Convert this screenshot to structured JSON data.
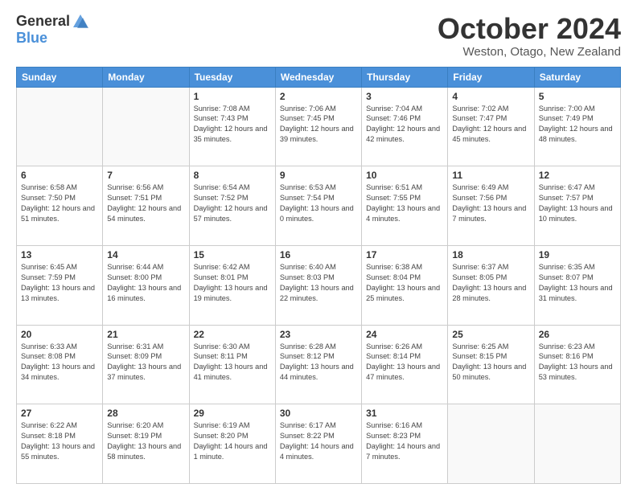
{
  "logo": {
    "general": "General",
    "blue": "Blue"
  },
  "header": {
    "month": "October 2024",
    "location": "Weston, Otago, New Zealand"
  },
  "days_of_week": [
    "Sunday",
    "Monday",
    "Tuesday",
    "Wednesday",
    "Thursday",
    "Friday",
    "Saturday"
  ],
  "weeks": [
    [
      {
        "day": "",
        "info": ""
      },
      {
        "day": "",
        "info": ""
      },
      {
        "day": "1",
        "info": "Sunrise: 7:08 AM\nSunset: 7:43 PM\nDaylight: 12 hours and 35 minutes."
      },
      {
        "day": "2",
        "info": "Sunrise: 7:06 AM\nSunset: 7:45 PM\nDaylight: 12 hours and 39 minutes."
      },
      {
        "day": "3",
        "info": "Sunrise: 7:04 AM\nSunset: 7:46 PM\nDaylight: 12 hours and 42 minutes."
      },
      {
        "day": "4",
        "info": "Sunrise: 7:02 AM\nSunset: 7:47 PM\nDaylight: 12 hours and 45 minutes."
      },
      {
        "day": "5",
        "info": "Sunrise: 7:00 AM\nSunset: 7:49 PM\nDaylight: 12 hours and 48 minutes."
      }
    ],
    [
      {
        "day": "6",
        "info": "Sunrise: 6:58 AM\nSunset: 7:50 PM\nDaylight: 12 hours and 51 minutes."
      },
      {
        "day": "7",
        "info": "Sunrise: 6:56 AM\nSunset: 7:51 PM\nDaylight: 12 hours and 54 minutes."
      },
      {
        "day": "8",
        "info": "Sunrise: 6:54 AM\nSunset: 7:52 PM\nDaylight: 12 hours and 57 minutes."
      },
      {
        "day": "9",
        "info": "Sunrise: 6:53 AM\nSunset: 7:54 PM\nDaylight: 13 hours and 0 minutes."
      },
      {
        "day": "10",
        "info": "Sunrise: 6:51 AM\nSunset: 7:55 PM\nDaylight: 13 hours and 4 minutes."
      },
      {
        "day": "11",
        "info": "Sunrise: 6:49 AM\nSunset: 7:56 PM\nDaylight: 13 hours and 7 minutes."
      },
      {
        "day": "12",
        "info": "Sunrise: 6:47 AM\nSunset: 7:57 PM\nDaylight: 13 hours and 10 minutes."
      }
    ],
    [
      {
        "day": "13",
        "info": "Sunrise: 6:45 AM\nSunset: 7:59 PM\nDaylight: 13 hours and 13 minutes."
      },
      {
        "day": "14",
        "info": "Sunrise: 6:44 AM\nSunset: 8:00 PM\nDaylight: 13 hours and 16 minutes."
      },
      {
        "day": "15",
        "info": "Sunrise: 6:42 AM\nSunset: 8:01 PM\nDaylight: 13 hours and 19 minutes."
      },
      {
        "day": "16",
        "info": "Sunrise: 6:40 AM\nSunset: 8:03 PM\nDaylight: 13 hours and 22 minutes."
      },
      {
        "day": "17",
        "info": "Sunrise: 6:38 AM\nSunset: 8:04 PM\nDaylight: 13 hours and 25 minutes."
      },
      {
        "day": "18",
        "info": "Sunrise: 6:37 AM\nSunset: 8:05 PM\nDaylight: 13 hours and 28 minutes."
      },
      {
        "day": "19",
        "info": "Sunrise: 6:35 AM\nSunset: 8:07 PM\nDaylight: 13 hours and 31 minutes."
      }
    ],
    [
      {
        "day": "20",
        "info": "Sunrise: 6:33 AM\nSunset: 8:08 PM\nDaylight: 13 hours and 34 minutes."
      },
      {
        "day": "21",
        "info": "Sunrise: 6:31 AM\nSunset: 8:09 PM\nDaylight: 13 hours and 37 minutes."
      },
      {
        "day": "22",
        "info": "Sunrise: 6:30 AM\nSunset: 8:11 PM\nDaylight: 13 hours and 41 minutes."
      },
      {
        "day": "23",
        "info": "Sunrise: 6:28 AM\nSunset: 8:12 PM\nDaylight: 13 hours and 44 minutes."
      },
      {
        "day": "24",
        "info": "Sunrise: 6:26 AM\nSunset: 8:14 PM\nDaylight: 13 hours and 47 minutes."
      },
      {
        "day": "25",
        "info": "Sunrise: 6:25 AM\nSunset: 8:15 PM\nDaylight: 13 hours and 50 minutes."
      },
      {
        "day": "26",
        "info": "Sunrise: 6:23 AM\nSunset: 8:16 PM\nDaylight: 13 hours and 53 minutes."
      }
    ],
    [
      {
        "day": "27",
        "info": "Sunrise: 6:22 AM\nSunset: 8:18 PM\nDaylight: 13 hours and 55 minutes."
      },
      {
        "day": "28",
        "info": "Sunrise: 6:20 AM\nSunset: 8:19 PM\nDaylight: 13 hours and 58 minutes."
      },
      {
        "day": "29",
        "info": "Sunrise: 6:19 AM\nSunset: 8:20 PM\nDaylight: 14 hours and 1 minute."
      },
      {
        "day": "30",
        "info": "Sunrise: 6:17 AM\nSunset: 8:22 PM\nDaylight: 14 hours and 4 minutes."
      },
      {
        "day": "31",
        "info": "Sunrise: 6:16 AM\nSunset: 8:23 PM\nDaylight: 14 hours and 7 minutes."
      },
      {
        "day": "",
        "info": ""
      },
      {
        "day": "",
        "info": ""
      }
    ]
  ]
}
